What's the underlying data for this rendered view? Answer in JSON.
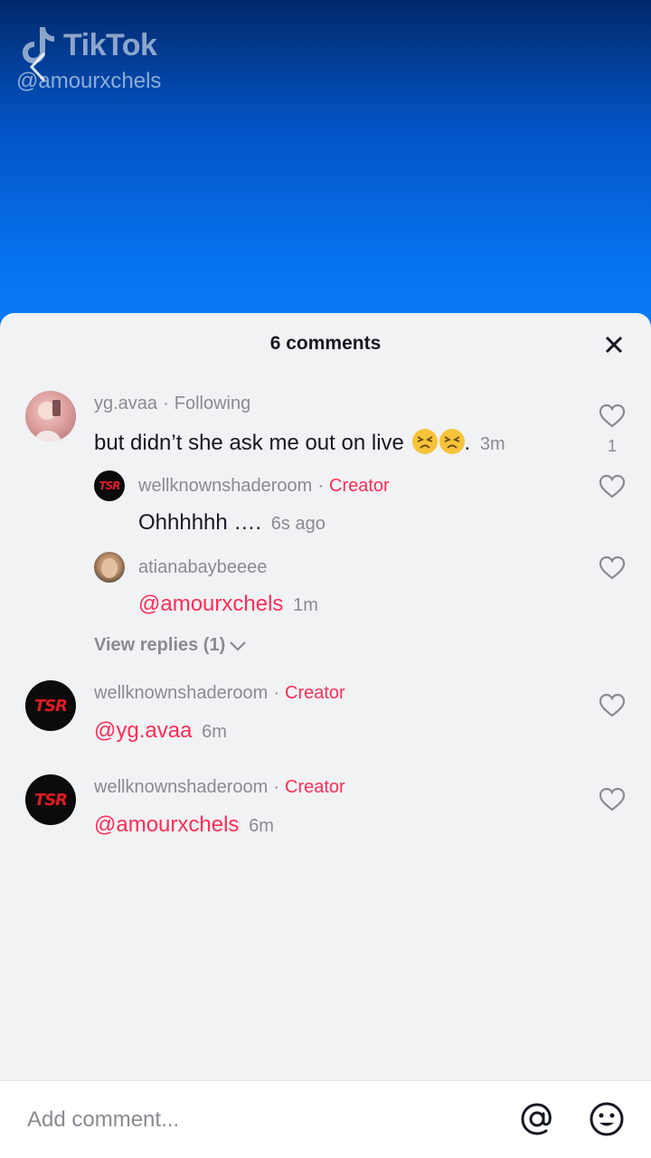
{
  "watermark": {
    "brand": "TikTok",
    "username": "@amourxchels"
  },
  "sheet": {
    "title": "6 comments"
  },
  "comments": [
    {
      "username": "yg.avaa",
      "relation": "Following",
      "text": "but didn’t she ask me out on live",
      "suffix": ".",
      "time": "3m",
      "likes": "1"
    },
    {
      "username": "wellknownshaderoom",
      "badge": "Creator",
      "text": "Ohhhhhh ….",
      "time": "6s ago"
    },
    {
      "username": "atianabaybeeee",
      "mention": "@amourxchels",
      "time": "1m"
    },
    {
      "username": "wellknownshaderoom",
      "badge": "Creator",
      "mention": "@yg.avaa",
      "time": "6m"
    },
    {
      "username": "wellknownshaderoom",
      "badge": "Creator",
      "mention": "@amourxchels",
      "time": "6m"
    }
  ],
  "view_replies": "View replies (1)",
  "composer": {
    "placeholder": "Add comment..."
  },
  "avatar_badge": "TSR",
  "colors": {
    "accent": "#fe2c55",
    "muted": "#8a8b91",
    "text": "#161823"
  }
}
